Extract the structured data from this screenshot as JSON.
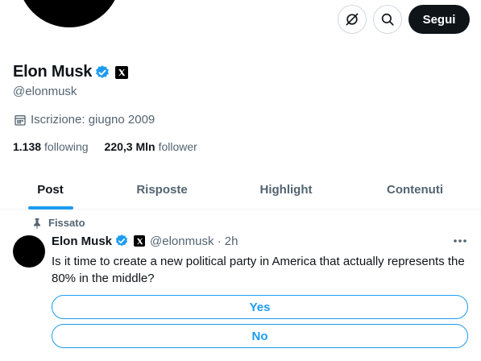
{
  "profile": {
    "name": "Elon Musk",
    "handle": "@elonmusk",
    "joined": "Iscrizione: giugno 2009",
    "following_count": "1.138",
    "following_label": "following",
    "followers_count": "220,3 Mln",
    "followers_label": "follower"
  },
  "header": {
    "follow_label": "Segui"
  },
  "tabs": [
    {
      "label": "Post",
      "active": true
    },
    {
      "label": "Risposte",
      "active": false
    },
    {
      "label": "Highlight",
      "active": false
    },
    {
      "label": "Contenuti",
      "active": false
    }
  ],
  "pinned_tweet": {
    "pinned_label": "Fissato",
    "author_name": "Elon Musk",
    "meta": "@elonmusk · 2h",
    "text": "Is it time to create a new political party in America that actually represents the 80% in the middle?",
    "poll_options": [
      "Yes",
      "No"
    ]
  },
  "colors": {
    "accent": "#1d9bf0",
    "text_primary": "#0f1419",
    "text_secondary": "#536471",
    "follow_button_bg": "#0f1419"
  },
  "icons": [
    "grok-icon",
    "search-icon",
    "verified-badge-icon",
    "x-affiliation-icon",
    "calendar-icon",
    "pin-icon",
    "more-icon"
  ]
}
